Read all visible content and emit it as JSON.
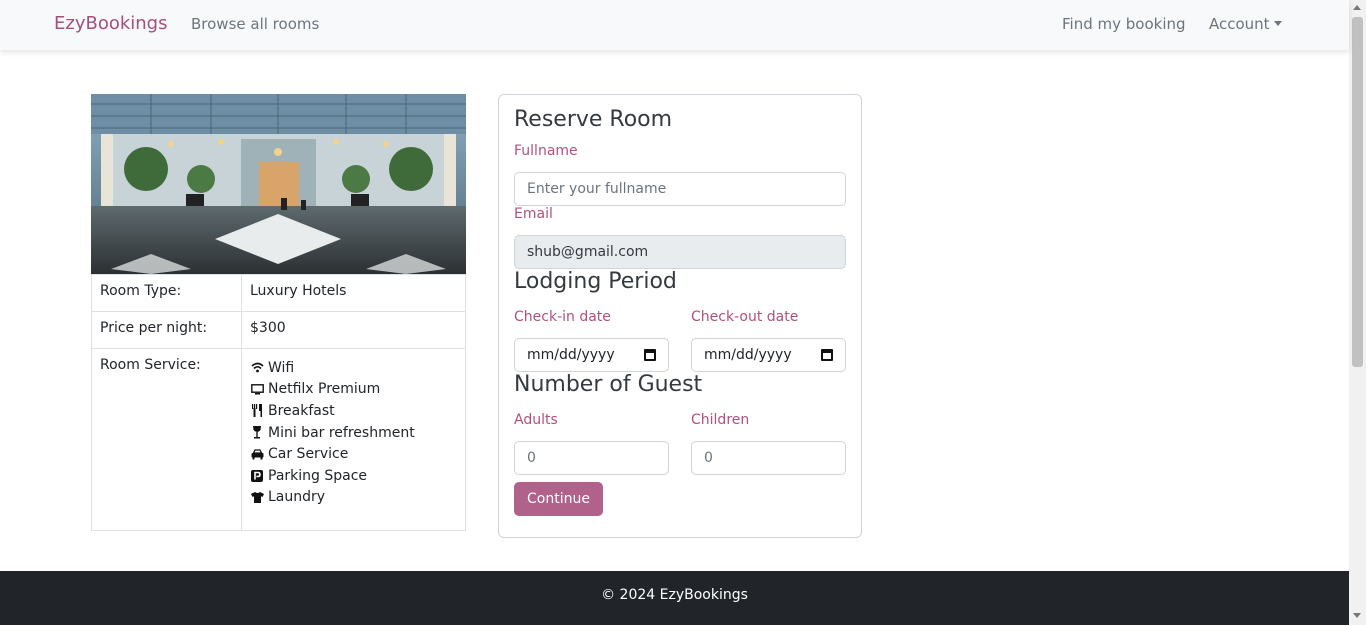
{
  "nav": {
    "brand": "EzyBookings",
    "browse_label": "Browse all rooms",
    "find_label": "Find my booking",
    "account_label": "Account"
  },
  "room": {
    "type_label": "Room Type:",
    "type_value": "Luxury Hotels",
    "price_label": "Price per night:",
    "price_value": "$300",
    "service_label": "Room Service:",
    "services": [
      {
        "icon": "wifi-icon",
        "label": "Wifi"
      },
      {
        "icon": "tv-icon",
        "label": "Netfilx Premium"
      },
      {
        "icon": "utensils-icon",
        "label": "Breakfast"
      },
      {
        "icon": "wine-glass-icon",
        "label": "Mini bar refreshment"
      },
      {
        "icon": "car-icon",
        "label": "Car Service"
      },
      {
        "icon": "parking-icon",
        "label": "Parking Space"
      },
      {
        "icon": "shirt-icon",
        "label": "Laundry"
      }
    ]
  },
  "form": {
    "title": "Reserve Room",
    "fullname_label": "Fullname",
    "fullname_placeholder": "Enter your fullname",
    "email_label": "Email",
    "email_value": "shub@gmail.com",
    "lodging_title": "Lodging Period",
    "checkin_label": "Check-in date",
    "checkin_value": "mm/dd/yyyy",
    "checkout_label": "Check-out date",
    "checkout_value": "mm/dd/yyyy",
    "guests_title": "Number of Guest",
    "adults_label": "Adults",
    "adults_value": "0",
    "children_label": "Children",
    "children_value": "0",
    "continue_label": "Continue"
  },
  "footer": {
    "text": "© 2024 EzyBookings"
  },
  "colors": {
    "accent": "#b0517f",
    "button": "#b0628a",
    "footer_bg": "#212529"
  }
}
